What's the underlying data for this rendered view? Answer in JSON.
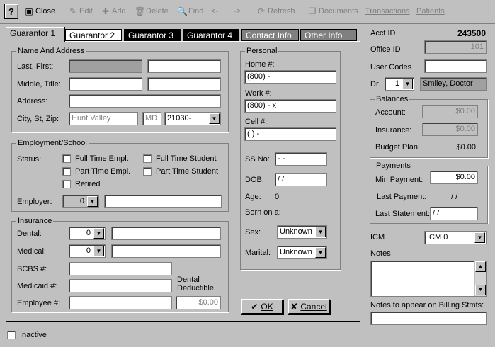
{
  "toolbar": {
    "help": "?",
    "close": "Close",
    "edit": "Edit",
    "add": "Add",
    "delete": "Delete",
    "find": "Find",
    "prev": "<-",
    "next": "->",
    "refresh": "Refresh",
    "documents": "Documents",
    "transactions": "Transactions",
    "patients": "Patients"
  },
  "tabs": [
    "Guarantor 1",
    "Guarantor 2",
    "Guarantor 3",
    "Guarantor 4",
    "Contact Info",
    "Other Info"
  ],
  "name_address": {
    "title": "Name And Address",
    "last_first_label": "Last, First:",
    "middle_title_label": "Middle, Title:",
    "address_label": "Address:",
    "city_label": "City, St, Zip:",
    "city": "Hunt Valley",
    "state": "MD",
    "zip": "21030-"
  },
  "employment": {
    "title": "Employment/School",
    "status_label": "Status:",
    "full_time_empl": "Full Time Empl.",
    "part_time_empl": "Part Time Empl.",
    "retired": "Retired",
    "full_time_student": "Full Time Student",
    "part_time_student": "Part Time Student",
    "employer_label": "Employer:",
    "employer_code": "0"
  },
  "insurance": {
    "title": "Insurance",
    "dental_label": "Dental:",
    "dental_code": "0",
    "medical_label": "Medical:",
    "medical_code": "0",
    "bcbs_label": "BCBS #:",
    "medicaid_label": "Medicaid #:",
    "employee_label": "Employee #:",
    "dental_deductible_label": "Dental Deductible",
    "dental_deductible_value": "$0.00"
  },
  "personal": {
    "title": "Personal",
    "home_label": "Home #:",
    "home_value": "(800)  -",
    "work_label": "Work #:",
    "work_value": "(800)  -    x",
    "cell_label": "Cell #:",
    "cell_value": "(  )  -",
    "ssn_label": "SS No:",
    "ssn_value": "  -  -",
    "dob_label": "DOB:",
    "dob_value": " / /",
    "age_label": "Age:",
    "age_value": "0",
    "born_label": "Born on a:",
    "sex_label": "Sex:",
    "sex_value": "Unknown",
    "marital_label": "Marital:",
    "marital_value": "Unknown"
  },
  "buttons": {
    "ok": "OK",
    "cancel": "Cancel"
  },
  "account": {
    "acct_id_label": "Acct ID",
    "acct_id": "243500",
    "office_id_label": "Office ID",
    "office_id": "101",
    "user_codes_label": "User Codes",
    "dr_label": "Dr",
    "dr_code": "1",
    "dr_name": "Smiley, Doctor"
  },
  "balances": {
    "title": "Balances",
    "account_label": "Account:",
    "account_value": "$0.00",
    "insurance_label": "Insurance:",
    "insurance_value": "$0.00",
    "budget_label": "Budget Plan:",
    "budget_value": "$0.00"
  },
  "payments": {
    "title": "Payments",
    "min_label": "Min Payment:",
    "min_value": "$0.00",
    "last_payment_label": "Last Payment:",
    "last_payment_value": "/ /",
    "last_statement_label": "Last Statement:",
    "last_statement_value": " / /"
  },
  "icm": {
    "label": "ICM",
    "value": "ICM 0"
  },
  "notes_label": "Notes",
  "billing_notes_label": "Notes to appear on Billing Stmts:",
  "inactive_label": "Inactive"
}
